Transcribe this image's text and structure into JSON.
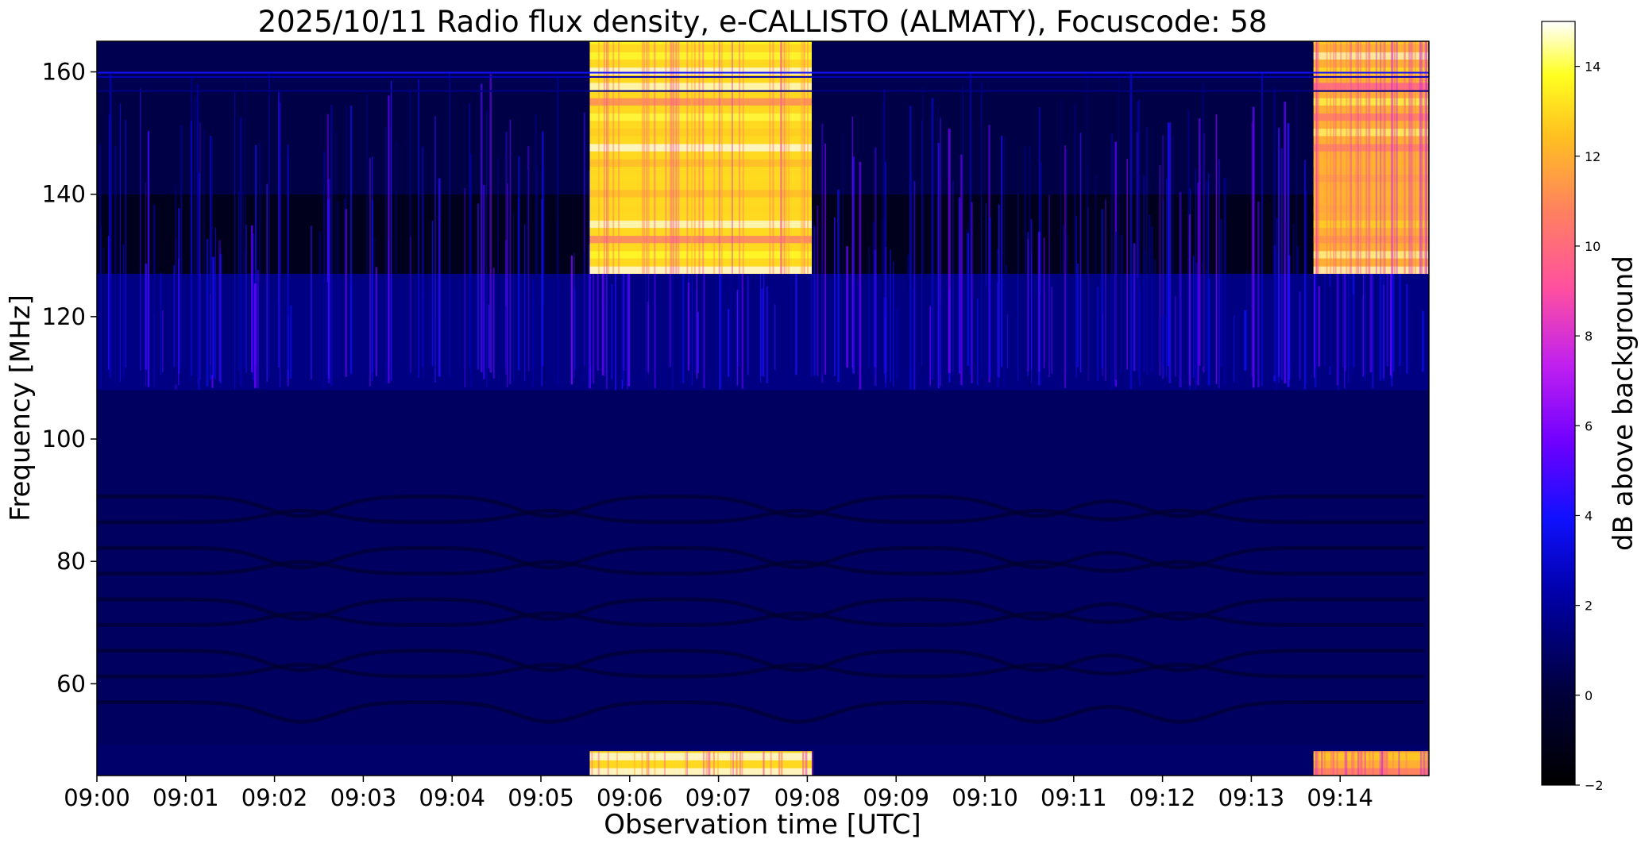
{
  "chart_data": {
    "type": "heatmap",
    "title": "2025/10/11  Radio flux density, e-CALLISTO (ALMATY), Focuscode: 58",
    "xlabel": "Observation time [UTC]",
    "ylabel": "Frequency [MHz]",
    "colorbar_label": "dB above background",
    "colormap": "gnuplot2",
    "xlim_minutes": [
      0,
      15
    ],
    "ylim": [
      45,
      165
    ],
    "clim": [
      -2,
      15
    ],
    "x_ticks": [
      {
        "minute": 0,
        "label": "09:00"
      },
      {
        "minute": 1,
        "label": "09:01"
      },
      {
        "minute": 2,
        "label": "09:02"
      },
      {
        "minute": 3,
        "label": "09:03"
      },
      {
        "minute": 4,
        "label": "09:04"
      },
      {
        "minute": 5,
        "label": "09:05"
      },
      {
        "minute": 6,
        "label": "09:06"
      },
      {
        "minute": 7,
        "label": "09:07"
      },
      {
        "minute": 8,
        "label": "09:08"
      },
      {
        "minute": 9,
        "label": "09:09"
      },
      {
        "minute": 10,
        "label": "09:10"
      },
      {
        "minute": 11,
        "label": "09:11"
      },
      {
        "minute": 12,
        "label": "09:12"
      },
      {
        "minute": 13,
        "label": "09:13"
      },
      {
        "minute": 14,
        "label": "09:14"
      }
    ],
    "y_ticks": [
      {
        "value": 60,
        "label": "60"
      },
      {
        "value": 80,
        "label": "80"
      },
      {
        "value": 100,
        "label": "100"
      },
      {
        "value": 120,
        "label": "120"
      },
      {
        "value": 140,
        "label": "140"
      },
      {
        "value": 160,
        "label": "160"
      }
    ],
    "colorbar_ticks": [
      {
        "value": -2,
        "label": "−2"
      },
      {
        "value": 0,
        "label": "0"
      },
      {
        "value": 2,
        "label": "2"
      },
      {
        "value": 4,
        "label": "4"
      },
      {
        "value": 6,
        "label": "6"
      },
      {
        "value": 8,
        "label": "8"
      },
      {
        "value": 10,
        "label": "10"
      },
      {
        "value": 12,
        "label": "12"
      },
      {
        "value": 14,
        "label": "14"
      }
    ],
    "series": [
      {
        "t_start": 5.55,
        "t_end": 8.05,
        "f_low": 127,
        "f_high": 165,
        "level_db": 13
      },
      {
        "t_start": 13.7,
        "t_end": 15.0,
        "f_low": 127,
        "f_high": 165,
        "level_db": 12
      },
      {
        "t_start": 5.55,
        "t_end": 8.05,
        "f_low": 45,
        "f_high": 49,
        "level_db": 13
      },
      {
        "t_start": 13.7,
        "t_end": 15.0,
        "f_low": 45,
        "f_high": 49,
        "level_db": 12
      }
    ],
    "background_bands": [
      {
        "f_low": 45,
        "f_high": 50,
        "level_db": 1
      },
      {
        "f_low": 50,
        "f_high": 108,
        "level_db": 0.8
      },
      {
        "f_low": 108,
        "f_high": 127,
        "level_db": 1.5
      },
      {
        "f_low": 127,
        "f_high": 140,
        "level_db": -1
      },
      {
        "f_low": 140,
        "f_high": 157,
        "level_db": 0.3
      },
      {
        "f_low": 157,
        "f_high": 165,
        "level_db": 0.5
      }
    ]
  }
}
